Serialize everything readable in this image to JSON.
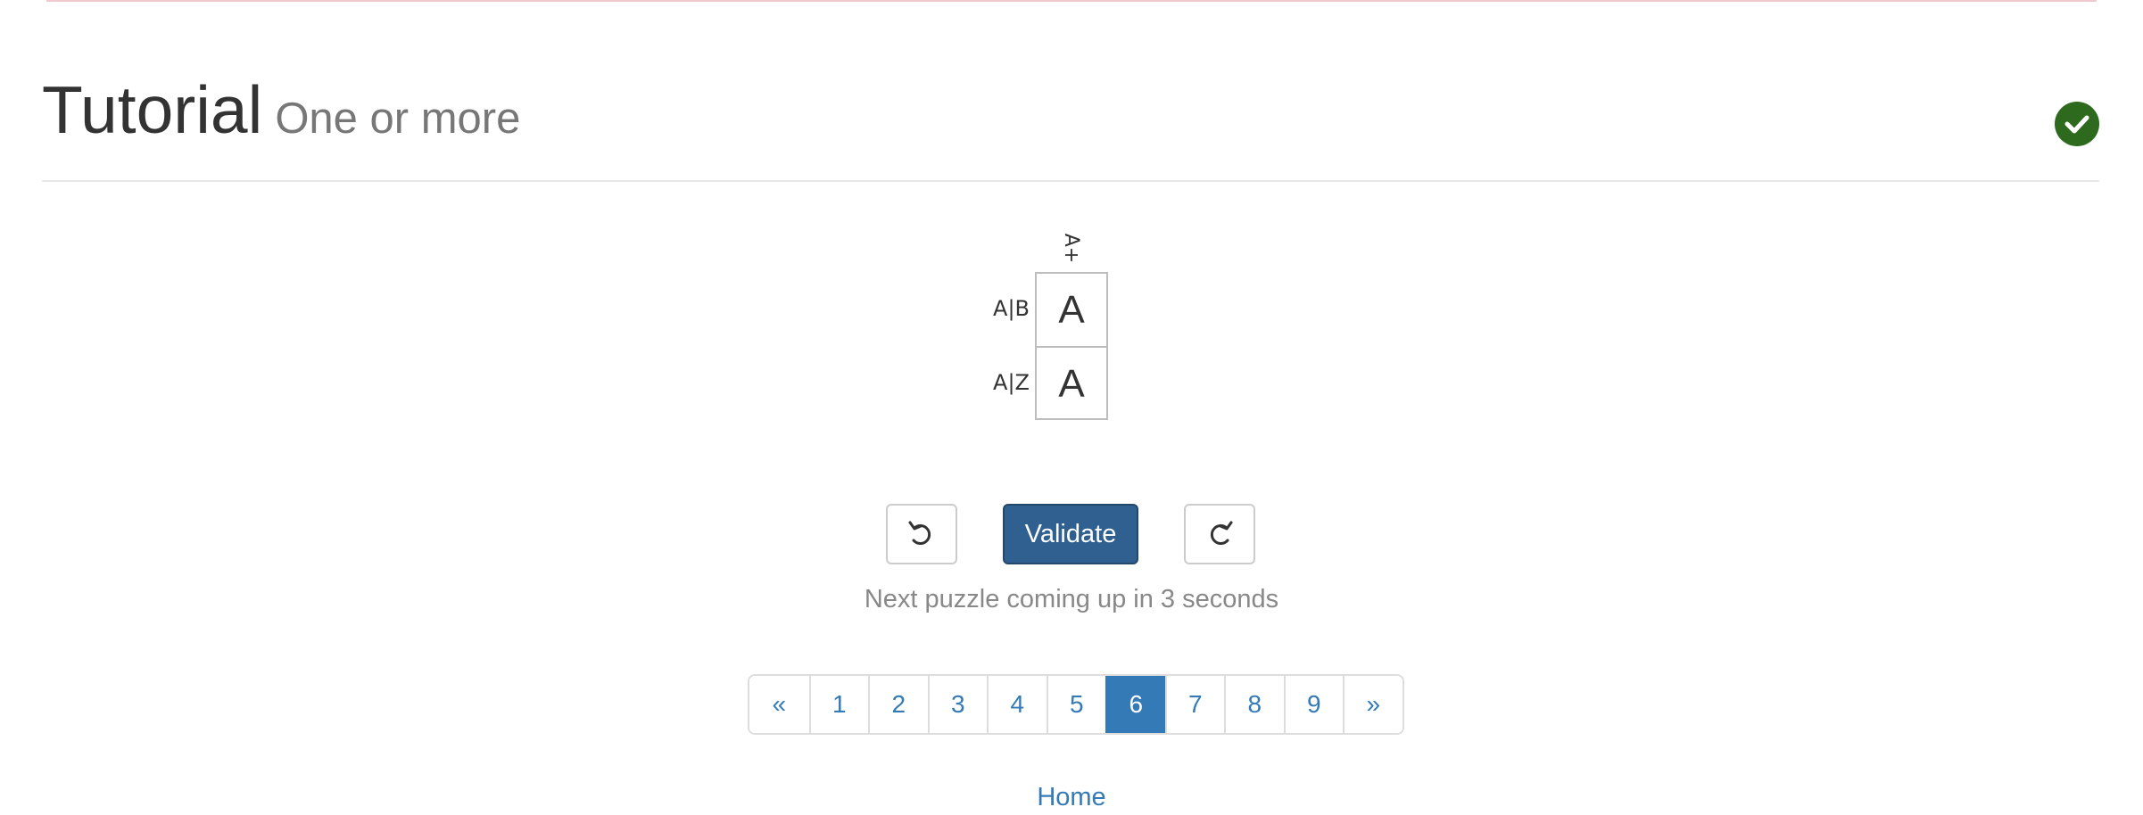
{
  "header": {
    "title": "Tutorial",
    "subtitle": "One or more",
    "solved_icon": "check-circle-icon",
    "solved_color": "#2d6a1e"
  },
  "puzzle": {
    "column_clues": [
      "A+"
    ],
    "row_clues": [
      "A|B",
      "A|Z"
    ],
    "cells": [
      [
        "A"
      ],
      [
        "A"
      ]
    ]
  },
  "controls": {
    "undo_icon": "undo-icon",
    "validate_label": "Validate",
    "redo_icon": "redo-icon",
    "accent_color": "#30608f"
  },
  "status": {
    "message": "Next puzzle coming up in 3 seconds"
  },
  "pagination": {
    "prev_label": "«",
    "next_label": "»",
    "pages": [
      "1",
      "2",
      "3",
      "4",
      "5",
      "6",
      "7",
      "8",
      "9"
    ],
    "active_page": "6",
    "link_color": "#337ab7"
  },
  "footer": {
    "home_label": "Home"
  }
}
